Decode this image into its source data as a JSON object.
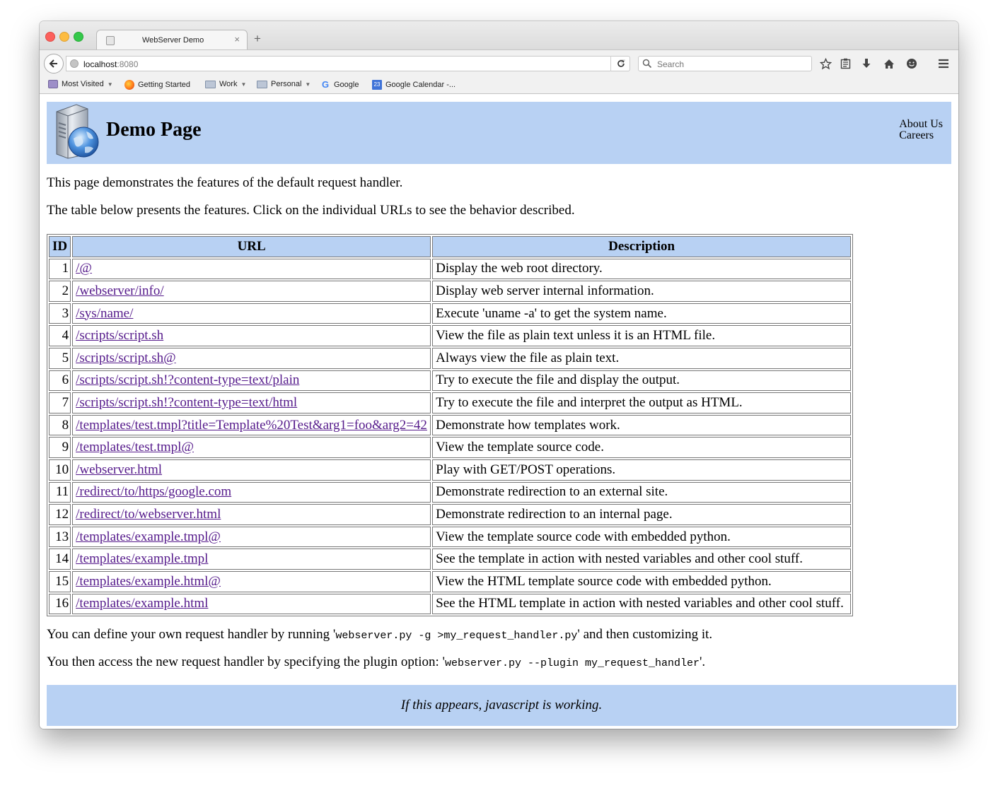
{
  "browser": {
    "tab_title": "WebServer Demo",
    "tab_close": "×",
    "new_tab": "+",
    "url_host": "localhost",
    "url_port": ":8080",
    "search_placeholder": "Search",
    "bookmarks": [
      {
        "label": "Most Visited",
        "icon": "most-visited-icon",
        "has_caret": true
      },
      {
        "label": "Getting Started",
        "icon": "firefox-icon",
        "has_caret": false
      },
      {
        "label": "Work",
        "icon": "folder-icon",
        "has_caret": true
      },
      {
        "label": "Personal",
        "icon": "folder-icon",
        "has_caret": true
      },
      {
        "label": "Google",
        "icon": "google-icon",
        "has_caret": false
      },
      {
        "label": "Google Calendar -...",
        "icon": "google-calendar-icon",
        "has_caret": false
      }
    ],
    "calendar_icon_text": "23"
  },
  "page": {
    "title": "Demo Page",
    "nav": {
      "about": "About Us",
      "careers": "Careers"
    },
    "intro1": "This page demonstrates the features of the default request handler.",
    "intro2": "The table below presents the features. Click on the individual URLs to see the behavior described.",
    "table": {
      "headers": {
        "id": "ID",
        "url": "URL",
        "description": "Description"
      },
      "rows": [
        {
          "id": "1",
          "url": "/@",
          "description": "Display the web root directory."
        },
        {
          "id": "2",
          "url": "/webserver/info/",
          "description": "Display web server internal information."
        },
        {
          "id": "3",
          "url": "/sys/name/",
          "description": "Execute 'uname -a' to get the system name."
        },
        {
          "id": "4",
          "url": "/scripts/script.sh",
          "description": "View the file as plain text unless it is an HTML file."
        },
        {
          "id": "5",
          "url": "/scripts/script.sh@",
          "description": "Always view the file as plain text."
        },
        {
          "id": "6",
          "url": "/scripts/script.sh!?content-type=text/plain",
          "description": "Try to execute the file and display the output."
        },
        {
          "id": "7",
          "url": "/scripts/script.sh!?content-type=text/html",
          "description": "Try to execute the file and interpret the output as HTML."
        },
        {
          "id": "8",
          "url": "/templates/test.tmpl?title=Template%20Test&arg1=foo&arg2=42",
          "description": "Demonstrate how templates work."
        },
        {
          "id": "9",
          "url": "/templates/test.tmpl@",
          "description": "View the template source code."
        },
        {
          "id": "10",
          "url": "/webserver.html",
          "description": "Play with GET/POST operations."
        },
        {
          "id": "11",
          "url": "/redirect/to/https/google.com",
          "description": "Demonstrate redirection to an external site."
        },
        {
          "id": "12",
          "url": "/redirect/to/webserver.html",
          "description": "Demonstrate redirection to an internal page."
        },
        {
          "id": "13",
          "url": "/templates/example.tmpl@",
          "description": "View the template source code with embedded python."
        },
        {
          "id": "14",
          "url": "/templates/example.tmpl",
          "description": "See the template in action with nested variables and other cool stuff."
        },
        {
          "id": "15",
          "url": "/templates/example.html@",
          "description": "View the HTML template source code with embedded python."
        },
        {
          "id": "16",
          "url": "/templates/example.html",
          "description": "See the HTML template in action with nested variables and other cool stuff."
        }
      ]
    },
    "para3": {
      "before": "You can define your own request handler by running '",
      "code": "webserver.py -g >my_request_handler.py",
      "after": "' and then customizing it."
    },
    "para4": {
      "before": "You then access the new request handler by specifying the plugin option: '",
      "code": "webserver.py --plugin my_request_handler",
      "after": "'."
    },
    "footer": "If this appears, javascript is working."
  },
  "colors": {
    "header_bg": "#b8d1f3",
    "visited_link": "#551a8b"
  }
}
